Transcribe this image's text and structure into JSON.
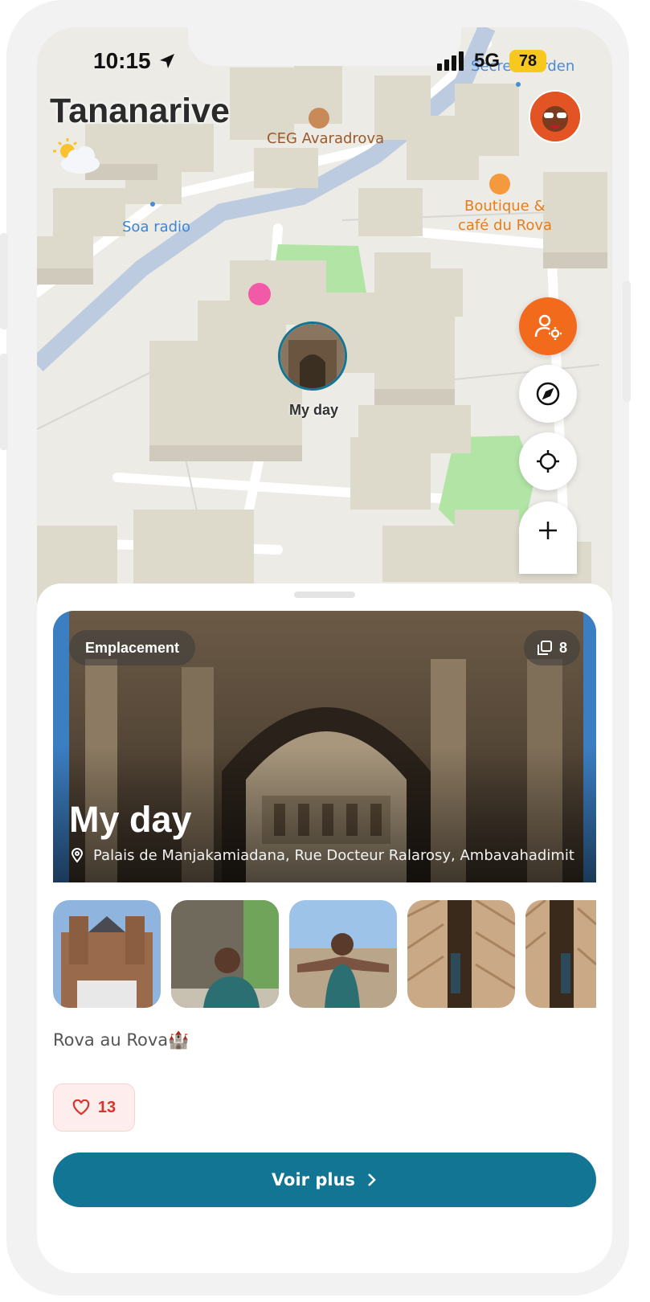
{
  "status_bar": {
    "time": "10:15",
    "network": "5G",
    "battery": "78"
  },
  "map": {
    "city": "Tananarive",
    "weather_icon": "partly-sunny-icon",
    "pois": {
      "ceg": "CEG Avaradrova",
      "secret_garden": "Secret Garden",
      "boutique_line1": "Boutique &",
      "boutique_line2": "café du Rova",
      "soa_radio": "Soa radio"
    },
    "story_label": "My day"
  },
  "colors": {
    "accent_orange": "#f26b1d",
    "primary_teal": "#137594",
    "like_red": "#d9342b"
  },
  "card": {
    "badge": "Emplacement",
    "photo_count": "8",
    "title": "My day",
    "address": "Palais de Manjakamiadana, Rue Docteur Ralarosy, Ambavahadimit...",
    "caption": "Rova au Rova🏰",
    "likes": "13",
    "cta": "Voir plus"
  }
}
